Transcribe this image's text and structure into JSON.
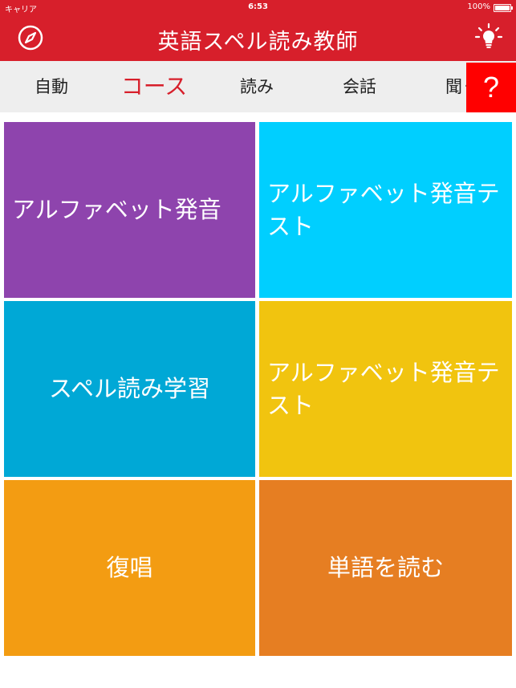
{
  "status": {
    "carrier": "キャリア",
    "time": "6:53",
    "battery": "100%",
    "battery_level": 1.0
  },
  "header": {
    "title": "英語スペル読み教師",
    "left_icon": "compass-icon",
    "right_icon": "lightbulb-icon"
  },
  "tabs": [
    {
      "label": "自動"
    },
    {
      "label": "コース"
    },
    {
      "label": "読み"
    },
    {
      "label": "会話"
    },
    {
      "label": "聞く"
    }
  ],
  "active_tab": "コース",
  "help": {
    "label": "?"
  },
  "tiles": [
    {
      "label": "アルファベット発音",
      "color": "#8e44ad"
    },
    {
      "label": "アルファベット発音テスト",
      "color": "#00cfff"
    },
    {
      "label": "スペル読み学習",
      "color": "#00a8d6"
    },
    {
      "label": "アルファベット発音テスト",
      "color": "#f1c40f"
    },
    {
      "label": "復唱",
      "color": "#f39c12"
    },
    {
      "label": "単語を読む",
      "color": "#e67e22"
    }
  ],
  "colors": {
    "brand": "#d71f2b",
    "tabbar": "#eeeeee",
    "help": "#ff0000"
  }
}
